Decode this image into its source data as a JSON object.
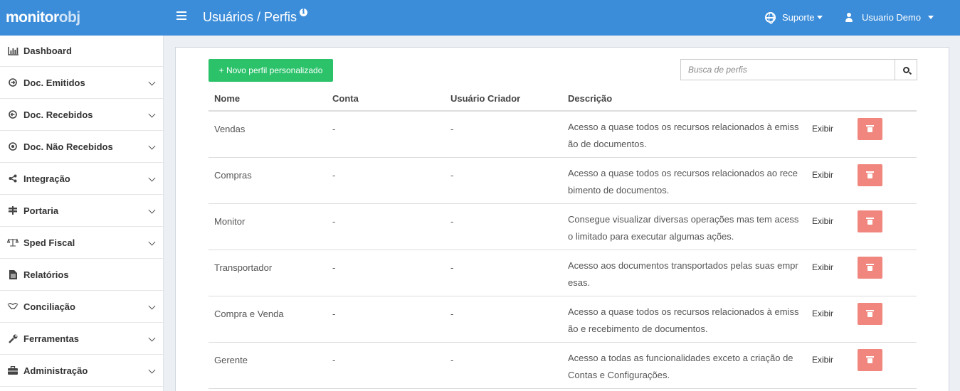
{
  "header": {
    "logo_bold": "monitor",
    "logo_light": "obj",
    "title": "Usuários / Perfis",
    "info_icon": "ℹ",
    "support_label": "Suporte",
    "user_label": "Usuario Demo"
  },
  "colors": {
    "topbar": "#3c8dd9",
    "new_button": "#2bc26a",
    "delete_button": "#f0867e"
  },
  "sidebar": {
    "items": [
      {
        "label": "Dashboard",
        "icon": "bar-chart-icon",
        "expandable": false
      },
      {
        "label": "Doc. Emitidos",
        "icon": "arrow-circle-right-icon",
        "expandable": true
      },
      {
        "label": "Doc. Recebidos",
        "icon": "arrow-circle-left-icon",
        "expandable": true
      },
      {
        "label": "Doc. Não Recebidos",
        "icon": "dot-circle-icon",
        "expandable": true
      },
      {
        "label": "Integração",
        "icon": "share-icon",
        "expandable": true
      },
      {
        "label": "Portaria",
        "icon": "signpost-icon",
        "expandable": true
      },
      {
        "label": "Sped Fiscal",
        "icon": "balance-scale-icon",
        "expandable": true
      },
      {
        "label": "Relatórios",
        "icon": "file-text-icon",
        "expandable": false
      },
      {
        "label": "Conciliação",
        "icon": "handshake-icon",
        "expandable": true
      },
      {
        "label": "Ferramentas",
        "icon": "wrench-icon",
        "expandable": true
      },
      {
        "label": "Administração",
        "icon": "briefcase-icon",
        "expandable": true
      }
    ]
  },
  "main": {
    "new_button_label": "+ Novo perfil personalizado",
    "search_placeholder": "Busca de perfis",
    "columns": [
      "Nome",
      "Conta",
      "Usuário Criador",
      "Descrição"
    ],
    "view_label": "Exibir",
    "rows": [
      {
        "name": "Vendas",
        "account": "-",
        "creator": "-",
        "description": "Acesso a quase todos os recursos relacionados à emissão de documentos."
      },
      {
        "name": "Compras",
        "account": "-",
        "creator": "-",
        "description": "Acesso a quase todos os recursos relacionados ao recebimento de documentos."
      },
      {
        "name": "Monitor",
        "account": "-",
        "creator": "-",
        "description": "Consegue visualizar diversas operações mas tem acesso limitado para executar algumas ações."
      },
      {
        "name": "Transportador",
        "account": "-",
        "creator": "-",
        "description": "Acesso aos documentos transportados pelas suas empresas."
      },
      {
        "name": "Compra e Venda",
        "account": "-",
        "creator": "-",
        "description": "Acesso a quase todos os recursos relacionados à emissão e recebimento de documentos."
      },
      {
        "name": "Gerente",
        "account": "-",
        "creator": "-",
        "description": "Acesso a todas as funcionalidades exceto a criação de Contas e Configurações."
      }
    ]
  }
}
